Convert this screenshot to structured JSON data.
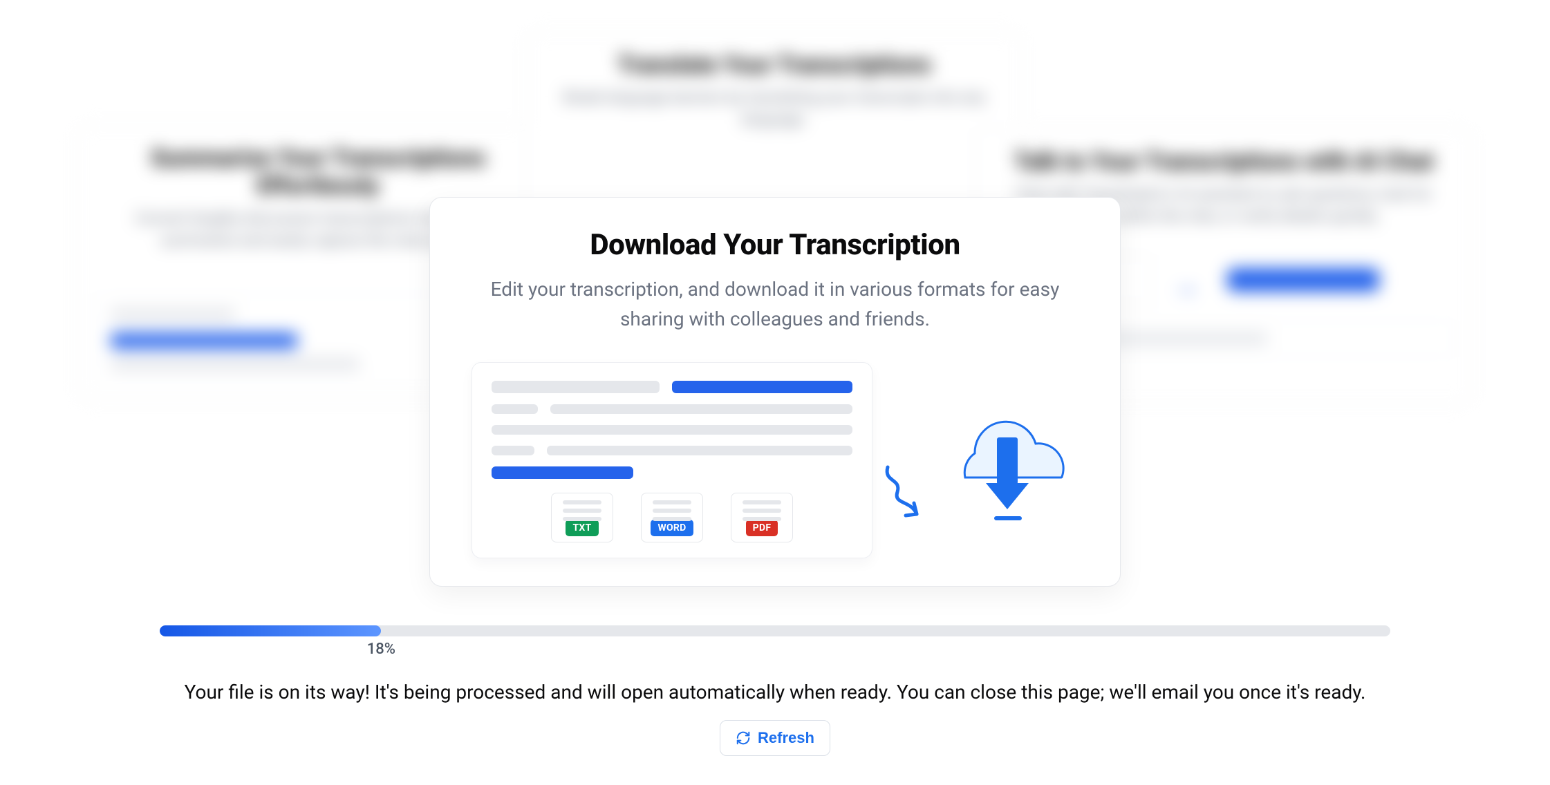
{
  "background_cards": {
    "summarize": {
      "title": "Summarize Your Transcriptions Effortlessly",
      "desc": "Convert lengthy discussion transcriptions into concise summaries and easily capture the main points."
    },
    "translate": {
      "title": "Translate Your Transcriptions",
      "desc": "Break language barriers by translating your transcripts into any language."
    },
    "chat": {
      "title": "Talk to Your Transcriptions with AI Chat",
      "desc": "Chat with Transkriptor's AI assistant to ask questions, look for details within the chat, or verify details quickly."
    }
  },
  "main_card": {
    "title": "Download Your Transcription",
    "desc": "Edit your transcription, and download it in various formats for easy sharing with colleagues and friends.",
    "formats": {
      "txt": "TXT",
      "word": "WORD",
      "pdf": "PDF"
    }
  },
  "progress": {
    "percent": 18,
    "label": "18%"
  },
  "status": {
    "message": "Your file is on its way! It's being processed and will open automatically when ready. You can close this page; we'll email you once it's ready."
  },
  "actions": {
    "refresh_label": "Refresh"
  }
}
